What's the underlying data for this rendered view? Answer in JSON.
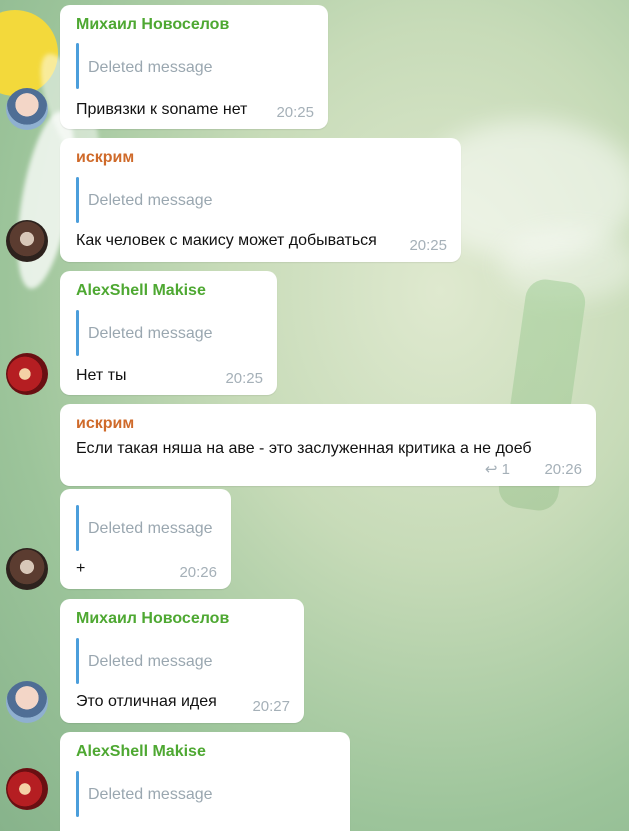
{
  "messages": [
    {
      "author": "Михаил Новоселов",
      "quoted": "Deleted message",
      "text": "Привязки к soname нет",
      "time": "20:25",
      "author_color": "#4ea832"
    },
    {
      "author": "искрим",
      "quoted": "Deleted message",
      "text": "Как человек с макису может добываться",
      "time": "20:25",
      "author_color": "#cf6a2a"
    },
    {
      "author": "AlexShell Makise",
      "quoted": "Deleted message",
      "text": "Нет ты",
      "time": "20:25",
      "author_color": "#4ea832"
    },
    {
      "author": "искрим",
      "text": "Если такая няша на аве - это заслуженная критика а не доеб",
      "reply_count": "1",
      "time": "20:26",
      "author_color": "#cf6a2a"
    },
    {
      "quoted": "Deleted message",
      "text": "+",
      "time": "20:26"
    },
    {
      "author": "Михаил Новоселов",
      "quoted": "Deleted message",
      "text": "Это отличная идея",
      "time": "20:27",
      "author_color": "#4ea832"
    },
    {
      "author": "AlexShell Makise",
      "quoted": "Deleted message",
      "author_color": "#4ea832"
    }
  ]
}
